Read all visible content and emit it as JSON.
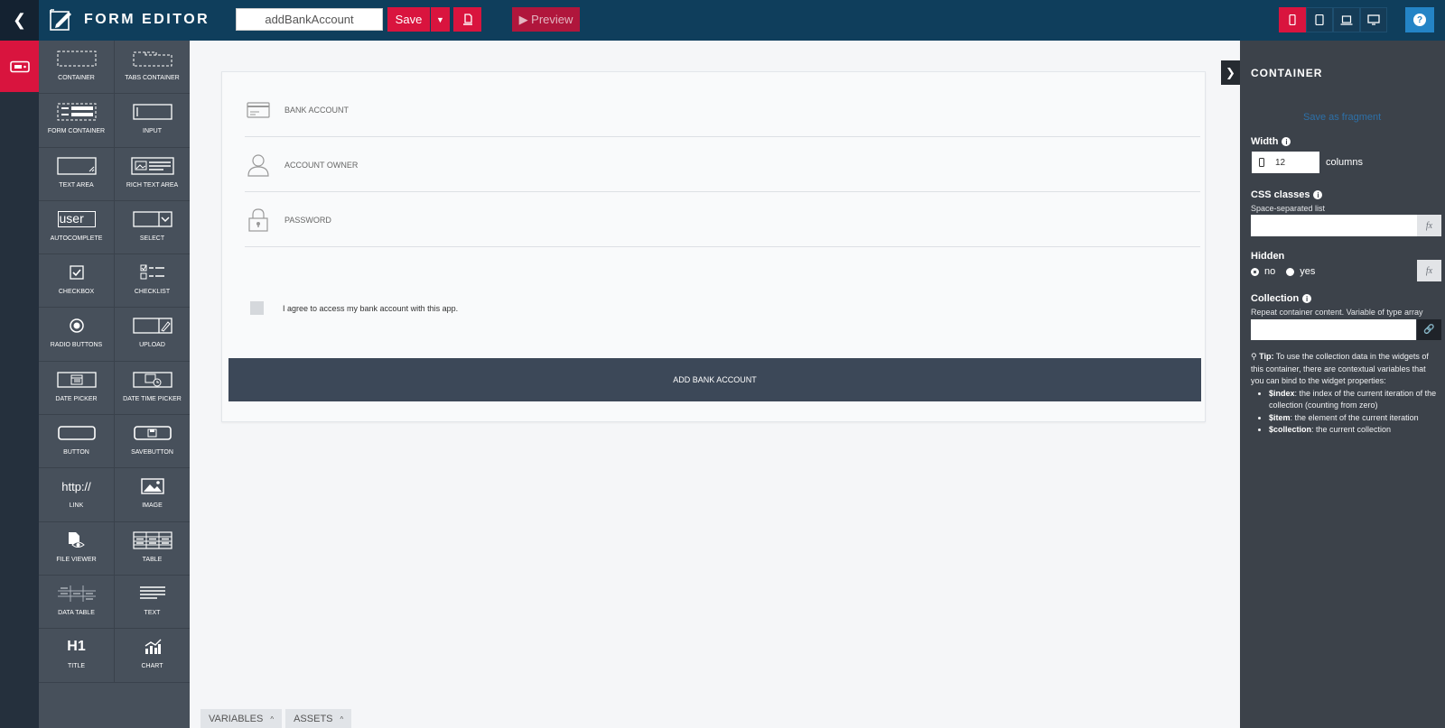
{
  "header": {
    "title": "FORM EDITOR",
    "form_name": "addBankAccount",
    "save_label": "Save",
    "preview_label": "▶ Preview",
    "colors": {
      "bar": "#0f3e5c",
      "accent": "#d9143e",
      "help": "#2484c6"
    }
  },
  "palette": {
    "items": [
      {
        "label": "CONTAINER",
        "icon": "container-icon"
      },
      {
        "label": "TABS CONTAINER",
        "icon": "tabs-container-icon"
      },
      {
        "label": "FORM CONTAINER",
        "icon": "form-container-icon"
      },
      {
        "label": "INPUT",
        "icon": "input-icon"
      },
      {
        "label": "TEXT AREA",
        "icon": "text-area-icon"
      },
      {
        "label": "RICH TEXT AREA",
        "icon": "rich-text-area-icon"
      },
      {
        "label": "AUTOCOMPLETE",
        "icon": "autocomplete-icon"
      },
      {
        "label": "SELECT",
        "icon": "select-icon"
      },
      {
        "label": "CHECKBOX",
        "icon": "checkbox-icon"
      },
      {
        "label": "CHECKLIST",
        "icon": "checklist-icon"
      },
      {
        "label": "RADIO BUTTONS",
        "icon": "radio-buttons-icon"
      },
      {
        "label": "UPLOAD",
        "icon": "upload-icon"
      },
      {
        "label": "DATE PICKER",
        "icon": "date-picker-icon"
      },
      {
        "label": "DATE TIME PICKER",
        "icon": "date-time-picker-icon"
      },
      {
        "label": "BUTTON",
        "icon": "button-icon"
      },
      {
        "label": "SAVEBUTTON",
        "icon": "save-button-icon"
      },
      {
        "label": "LINK",
        "icon": "link-icon"
      },
      {
        "label": "IMAGE",
        "icon": "image-icon"
      },
      {
        "label": "FILE VIEWER",
        "icon": "file-viewer-icon"
      },
      {
        "label": "TABLE",
        "icon": "table-icon"
      },
      {
        "label": "DATA TABLE",
        "icon": "data-table-icon"
      },
      {
        "label": "TEXT",
        "icon": "text-icon"
      },
      {
        "label": "TITLE",
        "icon": "title-icon"
      },
      {
        "label": "CHART",
        "icon": "chart-icon"
      }
    ],
    "autocomplete_glyph": "user",
    "link_glyph": "http://",
    "title_glyph": "H1"
  },
  "form": {
    "fields": [
      {
        "label": "BANK ACCOUNT",
        "icon": "credit-card-icon"
      },
      {
        "label": "ACCOUNT OWNER",
        "icon": "user-icon"
      },
      {
        "label": "PASSWORD",
        "icon": "lock-icon"
      }
    ],
    "checkbox_label": "I agree to access my bank account with this app.",
    "submit_label": "ADD BANK ACCOUNT"
  },
  "bottom_tabs": [
    {
      "label": "VARIABLES"
    },
    {
      "label": "ASSETS"
    }
  ],
  "panel": {
    "title": "CONTAINER",
    "save_fragment": "Save as fragment",
    "width_label": "Width",
    "width_value": "12",
    "width_unit": "columns",
    "css_label": "CSS classes",
    "css_hint": "Space-separated list",
    "fx": "fx",
    "hidden_label": "Hidden",
    "hidden_no": "no",
    "hidden_yes": "yes",
    "collection_label": "Collection",
    "collection_hint": "Repeat container content. Variable of type array",
    "tip_title": "Tip:",
    "tip_text": "To use the collection data in the widgets of this container, there are contextual variables that you can bind to the widget properties:",
    "tip_items": [
      {
        "name": "$index",
        "desc": ": the index of the current iteration of the collection (counting from zero)"
      },
      {
        "name": "$item",
        "desc": ": the element of the current iteration"
      },
      {
        "name": "$collection",
        "desc": ": the current collection"
      }
    ]
  }
}
